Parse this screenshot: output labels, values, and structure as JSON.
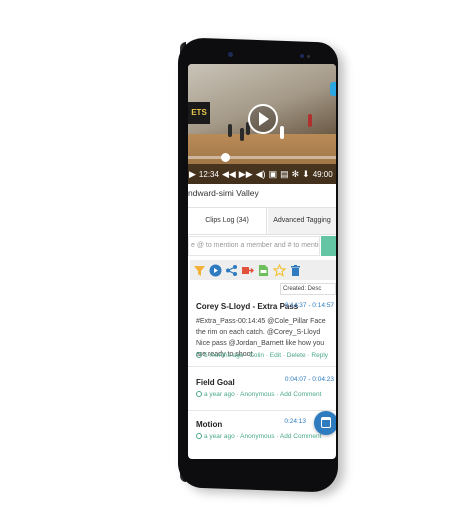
{
  "video": {
    "wall_sign": "ETS",
    "current_time": "12:34",
    "duration": "49:00",
    "progress": 0.25
  },
  "team_name": "ndward-simi Valley",
  "tabs": [
    {
      "label": "Clips Log (34)",
      "active": true
    },
    {
      "label": "Advanced Tagging",
      "active": false
    }
  ],
  "comment": {
    "placeholder": "e @ to mention a member and # to mention a"
  },
  "toolbar": {
    "icons": [
      "filter-icon",
      "play-circle-icon",
      "share-icon",
      "export-icon",
      "csv-file-icon",
      "star-icon",
      "trash-icon"
    ],
    "colors": {
      "filter": "#f3b13a",
      "play": "#2e7bbf",
      "share": "#2e7bbf",
      "export": "#e0533a",
      "csv": "#6cbf5a",
      "star": "#f3c23a",
      "trash": "#2e7bbf"
    }
  },
  "sort": {
    "label": "Created: Desc"
  },
  "clips": [
    {
      "title": "Corey S-Lloyd - Extra Pass",
      "time": "0:14:37 - 0:14:57",
      "body": "#Extra_Pass-00:14:45 @Cole_Pillar Face the rim on each catch. @Corey_S-Lloyd Nice pass @Jordan_Barnett like how you are ready to shoot.",
      "age": "5 months ago",
      "author": "Colin",
      "actions": [
        "Edit",
        "Delete",
        "Reply"
      ]
    },
    {
      "title": "Field Goal",
      "time": "0:04:07 - 0:04:23",
      "age": "a year ago",
      "author": "Anonymous",
      "actions": [
        "Add Comment"
      ]
    },
    {
      "title": "Motion",
      "time": "0:24:13",
      "age": "a year ago",
      "author": "Anonymous",
      "actions": [
        "Add Comment"
      ]
    }
  ],
  "accent_color": "#2e7bbf",
  "green_color": "#4aa88a"
}
